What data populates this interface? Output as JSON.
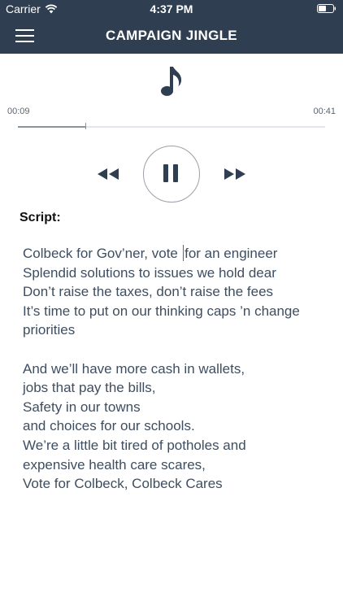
{
  "status_bar": {
    "carrier": "Carrier",
    "time": "4:37 PM"
  },
  "navbar": {
    "title": "CAMPAIGN JINGLE",
    "menu_icon": "hamburger-menu-icon"
  },
  "player": {
    "track_icon": "music-note-icon",
    "elapsed": "0:09",
    "elapsed_display": "00:09",
    "duration": "00:41",
    "progress_fraction": 0.22,
    "rewind_icon": "rewind-icon",
    "pause_icon": "pause-icon",
    "forward_icon": "fast-forward-icon",
    "state": "playing"
  },
  "script": {
    "heading": "Script:",
    "verse1": [
      "Colbeck for Gov’ner, vote for an engineer",
      "Splendid solutions to issues we hold dear",
      "Don’t raise the taxes, don’t raise the fees",
      "It’s time to put on our thinking caps ’n change",
      "priorities"
    ],
    "line1_before_caret": "Colbeck for Gov’ner, vote ",
    "line1_after_caret": "for an engineer",
    "verse2": [
      "And we’ll have more cash in wallets,",
      "jobs that pay the bills,",
      "Safety in our towns",
      "and choices for our schools.",
      "We’re a little bit tired of potholes and",
      "expensive health care scares,",
      "Vote for Colbeck, Colbeck Cares"
    ]
  },
  "colors": {
    "header_bg": "#2f3e50",
    "icon_dark": "#2f3e50",
    "script_text": "#3e4e60",
    "caret": "#3b6cd6"
  }
}
